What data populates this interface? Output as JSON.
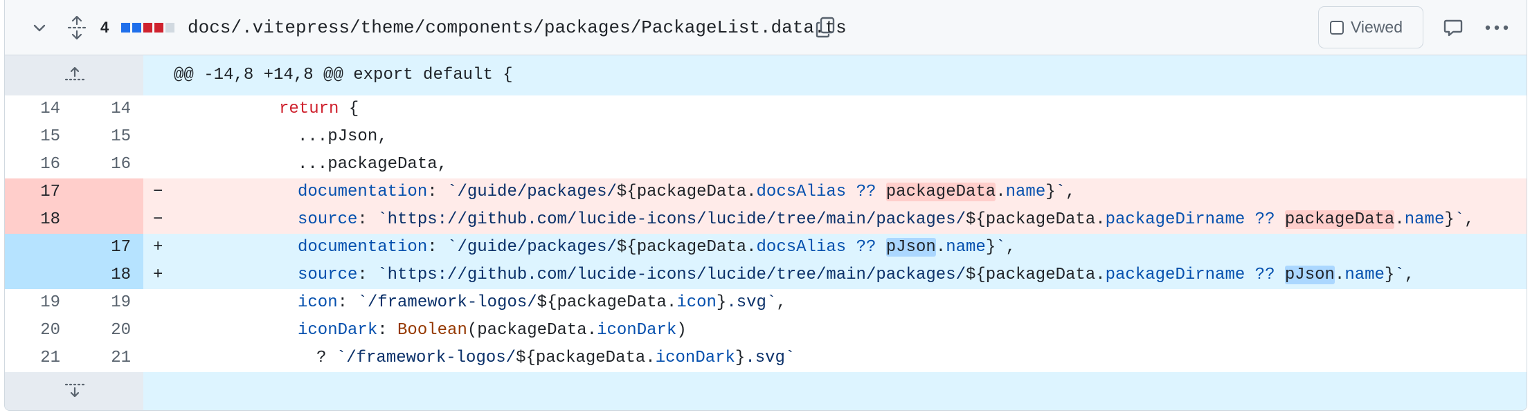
{
  "header": {
    "change_count": "4",
    "diffstat": [
      "#1f6feb",
      "#1f6feb",
      "#cf222e",
      "#cf222e",
      "#d1d9e0"
    ],
    "file_path": "docs/.vitepress/theme/components/packages/PackageList.data.ts",
    "viewed_label": "Viewed"
  },
  "hunk": {
    "header": "@@ -14,8 +14,8 @@ export default {"
  },
  "lines": [
    {
      "type": "ctx",
      "old": "14",
      "new": "14",
      "sign": "",
      "indent": 0,
      "tokens": [
        [
          "kw",
          "return"
        ],
        [
          "",
          " {"
        ]
      ]
    },
    {
      "type": "ctx",
      "old": "15",
      "new": "15",
      "sign": "",
      "indent": 1,
      "tokens": [
        [
          "",
          "...pJson,"
        ]
      ]
    },
    {
      "type": "ctx",
      "old": "16",
      "new": "16",
      "sign": "",
      "indent": 1,
      "tokens": [
        [
          "",
          "...packageData,"
        ]
      ]
    },
    {
      "type": "del",
      "old": "17",
      "new": "",
      "sign": "−",
      "indent": 1,
      "tokens": [
        [
          "bl",
          "documentation"
        ],
        [
          "",
          ": "
        ],
        [
          "str",
          "`/guide/packages/"
        ],
        [
          "",
          "${packageData."
        ],
        [
          "bl",
          "docsAlias"
        ],
        [
          "",
          " "
        ],
        [
          "bl",
          "??"
        ],
        [
          "",
          " "
        ],
        [
          "hldel",
          "packageData"
        ],
        [
          "",
          "."
        ],
        [
          "bl",
          "name"
        ],
        [
          "",
          "}"
        ],
        [
          "str",
          "`"
        ],
        [
          "",
          ","
        ]
      ]
    },
    {
      "type": "del",
      "old": "18",
      "new": "",
      "sign": "−",
      "indent": 1,
      "tokens": [
        [
          "bl",
          "source"
        ],
        [
          "",
          ": "
        ],
        [
          "str",
          "`https://github.com/lucide-icons/lucide/tree/main/packages/"
        ],
        [
          "",
          "${packageData."
        ],
        [
          "bl",
          "packageDirname"
        ],
        [
          "",
          " "
        ],
        [
          "bl",
          "??"
        ],
        [
          "",
          " "
        ],
        [
          "hldel",
          "packageData"
        ],
        [
          "",
          "."
        ],
        [
          "bl",
          "name"
        ],
        [
          "",
          "}"
        ],
        [
          "str",
          "`"
        ],
        [
          "",
          ","
        ]
      ]
    },
    {
      "type": "add",
      "old": "",
      "new": "17",
      "sign": "+",
      "indent": 1,
      "tokens": [
        [
          "bl",
          "documentation"
        ],
        [
          "",
          ": "
        ],
        [
          "str",
          "`/guide/packages/"
        ],
        [
          "",
          "${packageData."
        ],
        [
          "bl",
          "docsAlias"
        ],
        [
          "",
          " "
        ],
        [
          "bl",
          "??"
        ],
        [
          "",
          " "
        ],
        [
          "hladd",
          "pJson"
        ],
        [
          "",
          "."
        ],
        [
          "bl",
          "name"
        ],
        [
          "",
          "}"
        ],
        [
          "str",
          "`"
        ],
        [
          "",
          ","
        ]
      ]
    },
    {
      "type": "add",
      "old": "",
      "new": "18",
      "sign": "+",
      "indent": 1,
      "tokens": [
        [
          "bl",
          "source"
        ],
        [
          "",
          ": "
        ],
        [
          "str",
          "`https://github.com/lucide-icons/lucide/tree/main/packages/"
        ],
        [
          "",
          "${packageData."
        ],
        [
          "bl",
          "packageDirname"
        ],
        [
          "",
          " "
        ],
        [
          "bl",
          "??"
        ],
        [
          "",
          " "
        ],
        [
          "hladd",
          "pJson"
        ],
        [
          "",
          "."
        ],
        [
          "bl",
          "name"
        ],
        [
          "",
          "}"
        ],
        [
          "str",
          "`"
        ],
        [
          "",
          ","
        ]
      ]
    },
    {
      "type": "ctx",
      "old": "19",
      "new": "19",
      "sign": "",
      "indent": 1,
      "tokens": [
        [
          "bl",
          "icon"
        ],
        [
          "",
          ": "
        ],
        [
          "str",
          "`/framework-logos/"
        ],
        [
          "",
          "${packageData."
        ],
        [
          "bl",
          "icon"
        ],
        [
          "",
          "}"
        ],
        [
          "str",
          ".svg`"
        ],
        [
          "",
          ","
        ]
      ]
    },
    {
      "type": "ctx",
      "old": "20",
      "new": "20",
      "sign": "",
      "indent": 1,
      "tokens": [
        [
          "bl",
          "iconDark"
        ],
        [
          "",
          ": "
        ],
        [
          "fn",
          "Boolean"
        ],
        [
          "",
          "(packageData."
        ],
        [
          "bl",
          "iconDark"
        ],
        [
          "",
          ")"
        ]
      ]
    },
    {
      "type": "ctx",
      "old": "21",
      "new": "21",
      "sign": "",
      "indent": 2,
      "tokens": [
        [
          "",
          "? "
        ],
        [
          "str",
          "`/framework-logos/"
        ],
        [
          "",
          "${packageData."
        ],
        [
          "bl",
          "iconDark"
        ],
        [
          "",
          "}"
        ],
        [
          "str",
          ".svg`"
        ]
      ]
    }
  ]
}
